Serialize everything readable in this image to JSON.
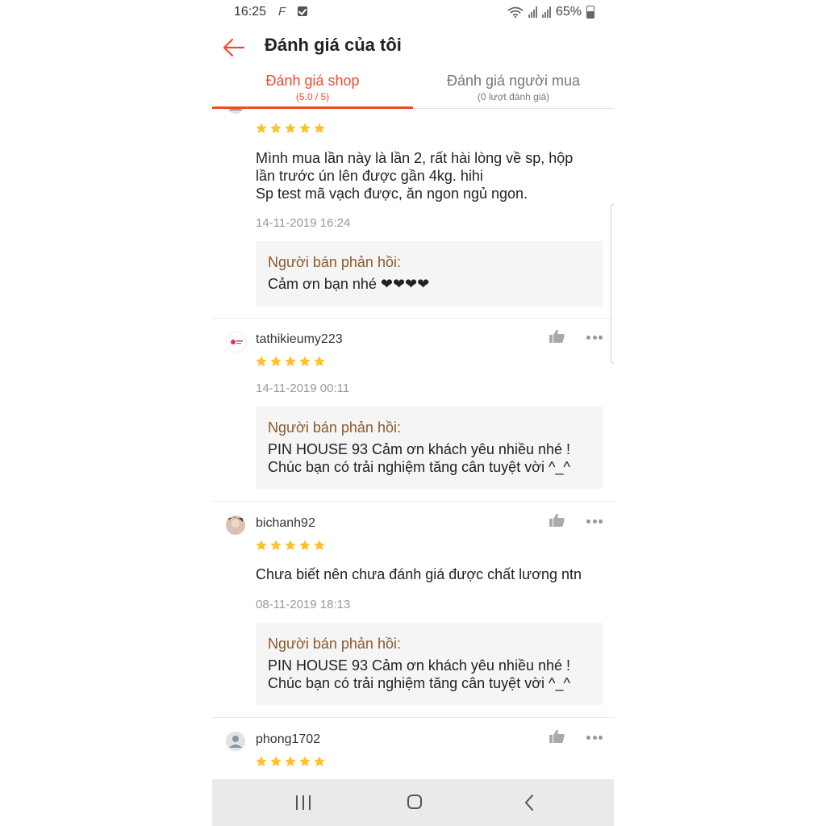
{
  "status_bar": {
    "time": "16:25",
    "f_icon": "F",
    "battery": "65%"
  },
  "header": {
    "title": "Đánh giá của tôi"
  },
  "tabs": [
    {
      "label": "Đánh giá shop",
      "sub": "(5.0 / 5)",
      "active": true
    },
    {
      "label": "Đánh giá người mua",
      "sub": "(0 lượt đánh giá)",
      "active": false
    }
  ],
  "reviews": [
    {
      "username": "",
      "rating": 5,
      "comment": [
        "Mình mua lần này là lần 2, rất hài lòng về sp, hộp",
        "lần trước ún lên được gần 4kg. hihi",
        "Sp test mã vạch được, ăn ngon ngủ ngon."
      ],
      "date": "14-11-2019 16:24",
      "reply_label": "Người bán phản hồi:",
      "reply": [
        "Cảm ơn bạn nhé ❤❤❤❤"
      ]
    },
    {
      "username": "tathikieumy223",
      "rating": 5,
      "comment": [],
      "date": "14-11-2019 00:11",
      "reply_label": "Người bán phản hồi:",
      "reply": [
        "PIN HOUSE 93 Cảm ơn khách yêu nhiều nhé !",
        "Chúc bạn có trải nghiệm tăng cân tuyệt vời ^_^"
      ]
    },
    {
      "username": "bichanh92",
      "rating": 5,
      "comment": [
        "Chưa biết nên chưa đánh giá được chất lương ntn"
      ],
      "date": "08-11-2019 18:13",
      "reply_label": "Người bán phản hồi:",
      "reply": [
        "PIN HOUSE 93 Cảm ơn khách yêu nhiều nhé !",
        "Chúc bạn có trải nghiệm tăng cân tuyệt vời ^_^"
      ]
    },
    {
      "username": "phong1702",
      "rating": 5,
      "comment": [],
      "date": "",
      "reply_label": "",
      "reply": []
    }
  ],
  "colors": {
    "accent": "#ee4d2d",
    "star": "#ffc02d",
    "reply_label": "#8b5a2b"
  }
}
